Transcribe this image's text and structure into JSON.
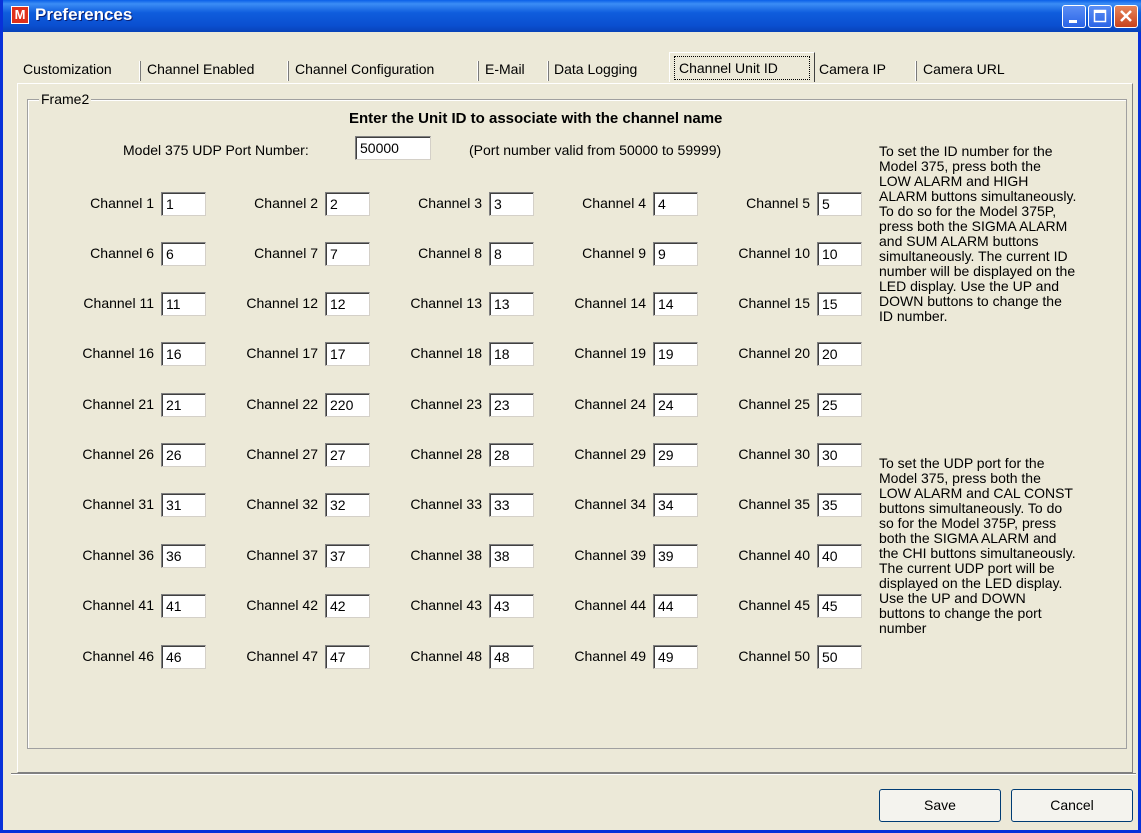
{
  "window": {
    "title": "Preferences",
    "app_icon_letter": "M"
  },
  "tabs": [
    {
      "label": "Customization"
    },
    {
      "label": "Channel Enabled"
    },
    {
      "label": "Channel Configuration"
    },
    {
      "label": "E-Mail"
    },
    {
      "label": "Data Logging"
    },
    {
      "label": "Channel Unit ID",
      "active": true
    },
    {
      "label": "Camera IP"
    },
    {
      "label": "Camera URL"
    }
  ],
  "frame": {
    "legend": "Frame2",
    "heading": "Enter the Unit ID to associate with the channel name"
  },
  "port": {
    "label": "Model 375 UDP Port Number:",
    "value": "50000",
    "note": "(Port number valid from 50000 to 59999)"
  },
  "channels": [
    {
      "label": "Channel 1",
      "value": "1"
    },
    {
      "label": "Channel 2",
      "value": "2"
    },
    {
      "label": "Channel 3",
      "value": "3"
    },
    {
      "label": "Channel 4",
      "value": "4"
    },
    {
      "label": "Channel 5",
      "value": "5"
    },
    {
      "label": "Channel 6",
      "value": "6"
    },
    {
      "label": "Channel 7",
      "value": "7"
    },
    {
      "label": "Channel 8",
      "value": "8"
    },
    {
      "label": "Channel 9",
      "value": "9"
    },
    {
      "label": "Channel 10",
      "value": "10"
    },
    {
      "label": "Channel 11",
      "value": "11"
    },
    {
      "label": "Channel 12",
      "value": "12"
    },
    {
      "label": "Channel 13",
      "value": "13"
    },
    {
      "label": "Channel 14",
      "value": "14"
    },
    {
      "label": "Channel 15",
      "value": "15"
    },
    {
      "label": "Channel 16",
      "value": "16"
    },
    {
      "label": "Channel 17",
      "value": "17"
    },
    {
      "label": "Channel 18",
      "value": "18"
    },
    {
      "label": "Channel 19",
      "value": "19"
    },
    {
      "label": "Channel 20",
      "value": "20"
    },
    {
      "label": "Channel 21",
      "value": "21"
    },
    {
      "label": "Channel 22",
      "value": "220"
    },
    {
      "label": "Channel 23",
      "value": "23"
    },
    {
      "label": "Channel 24",
      "value": "24"
    },
    {
      "label": "Channel 25",
      "value": "25"
    },
    {
      "label": "Channel 26",
      "value": "26"
    },
    {
      "label": "Channel 27",
      "value": "27"
    },
    {
      "label": "Channel 28",
      "value": "28"
    },
    {
      "label": "Channel 29",
      "value": "29"
    },
    {
      "label": "Channel 30",
      "value": "30"
    },
    {
      "label": "Channel 31",
      "value": "31"
    },
    {
      "label": "Channel 32",
      "value": "32"
    },
    {
      "label": "Channel 33",
      "value": "33"
    },
    {
      "label": "Channel 34",
      "value": "34"
    },
    {
      "label": "Channel 35",
      "value": "35"
    },
    {
      "label": "Channel 36",
      "value": "36"
    },
    {
      "label": "Channel 37",
      "value": "37"
    },
    {
      "label": "Channel 38",
      "value": "38"
    },
    {
      "label": "Channel 39",
      "value": "39"
    },
    {
      "label": "Channel 40",
      "value": "40"
    },
    {
      "label": "Channel 41",
      "value": "41"
    },
    {
      "label": "Channel 42",
      "value": "42"
    },
    {
      "label": "Channel 43",
      "value": "43"
    },
    {
      "label": "Channel 44",
      "value": "44"
    },
    {
      "label": "Channel 45",
      "value": "45"
    },
    {
      "label": "Channel 46",
      "value": "46"
    },
    {
      "label": "Channel 47",
      "value": "47"
    },
    {
      "label": "Channel 48",
      "value": "48"
    },
    {
      "label": "Channel 49",
      "value": "49"
    },
    {
      "label": "Channel 50",
      "value": "50"
    }
  ],
  "help": {
    "id_lines": [
      "To set the ID number for the",
      "Model 375, press both the",
      "LOW ALARM and HIGH",
      "ALARM buttons simultaneously.",
      "To do so for the Model 375P,",
      "press both the SIGMA ALARM",
      "and SUM ALARM buttons",
      "simultaneously. The current ID",
      "number will be displayed on the",
      "LED display. Use the UP and",
      "DOWN buttons to change the",
      "ID number."
    ],
    "port_lines": [
      "To set the UDP port for the",
      "Model 375, press both the",
      "LOW ALARM and CAL CONST",
      "buttons simultaneously. To do",
      "so for the Model 375P, press",
      "both the SIGMA ALARM and",
      "the CHI buttons simultaneously.",
      "The current UDP port will be",
      "displayed on the LED display.",
      "Use the UP and DOWN",
      "buttons to change the port",
      "number"
    ]
  },
  "buttons": {
    "save": "Save",
    "cancel": "Cancel"
  }
}
